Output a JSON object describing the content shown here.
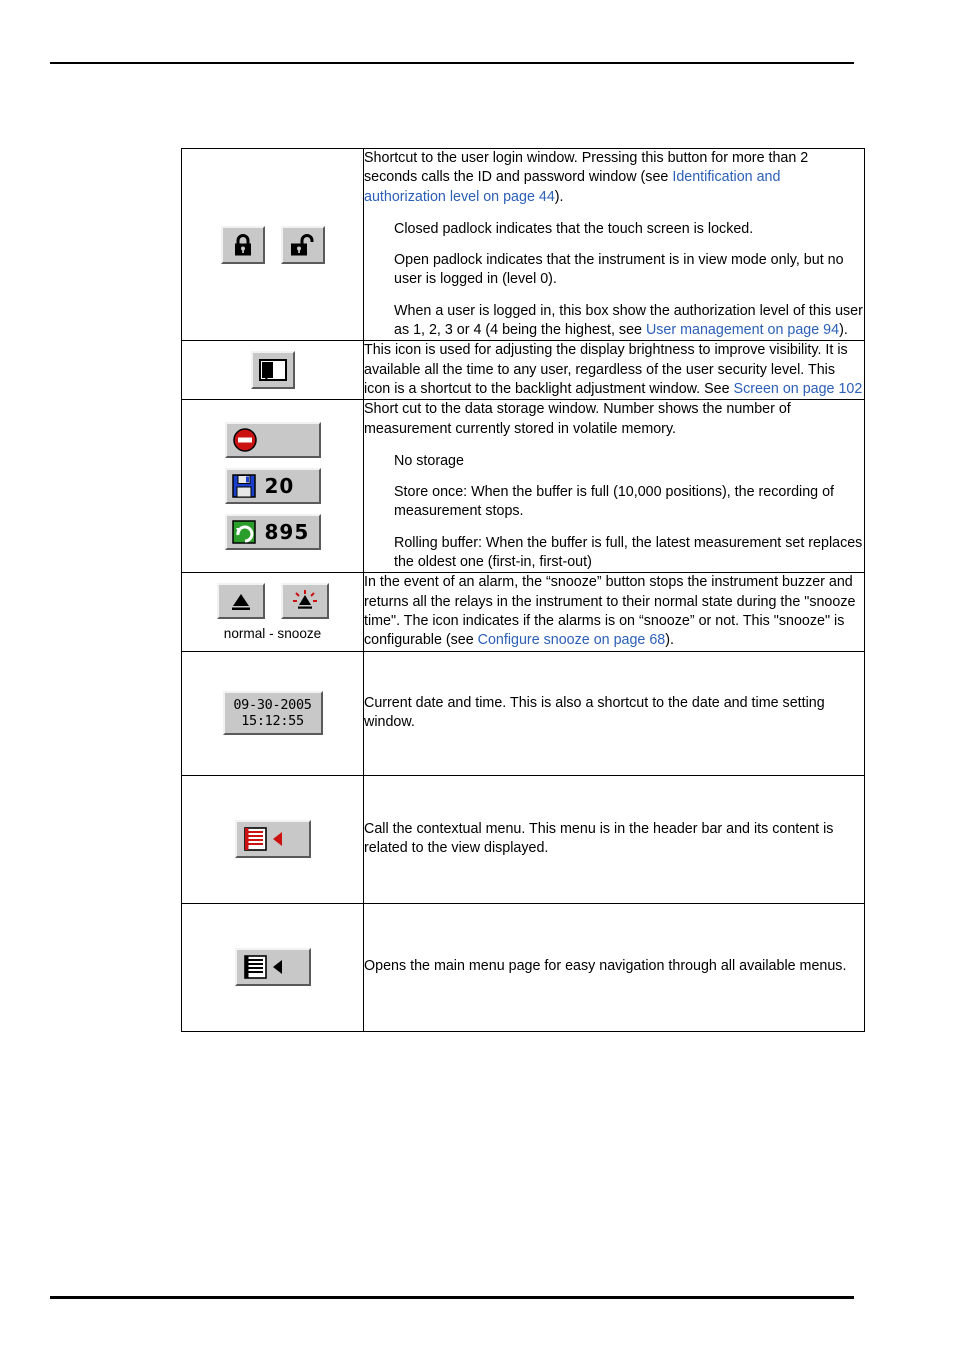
{
  "page": {
    "rows": [
      {
        "id": "login-lock",
        "icon_name": "padlock-icons",
        "paragraphs": [
          {
            "style": "flush",
            "segments": [
              {
                "text": "Shortcut to the user login window. Pressing this button for more than 2 seconds calls the ID and password window (see ",
                "link": false
              },
              {
                "text": "Identification and authorization level on page 44",
                "link": true
              },
              {
                "text": ").",
                "link": false
              }
            ]
          },
          {
            "style": "indent",
            "segments": [
              {
                "text": "Closed padlock indicates that the touch screen is locked.",
                "link": false
              }
            ]
          },
          {
            "style": "indent",
            "segments": [
              {
                "text": "Open padlock indicates that the instrument is in view mode only, but no user is logged in (level 0).",
                "link": false
              }
            ]
          },
          {
            "style": "indent",
            "segments": [
              {
                "text": "When a user is logged in, this box show the authorization level of this user as 1, 2, 3 or 4 (4 being the highest, see ",
                "link": false
              },
              {
                "text": "User management on page 94",
                "link": true
              },
              {
                "text": ").",
                "link": false
              }
            ]
          }
        ]
      },
      {
        "id": "brightness",
        "icon_name": "brightness-icon",
        "paragraphs": [
          {
            "style": "flush",
            "segments": [
              {
                "text": "This icon is used for adjusting the display brightness to improve visibility. It is available all the time to any user, regardless of the user security level. This icon is a shortcut to the backlight adjustment window. See ",
                "link": false
              },
              {
                "text": "Screen on page 102",
                "link": true
              }
            ]
          }
        ]
      },
      {
        "id": "data-storage",
        "icon_name": "storage-icons",
        "store_values": [
          "20",
          "895"
        ],
        "paragraphs": [
          {
            "style": "flush",
            "segments": [
              {
                "text": "Short cut to the data storage window. Number shows the number of measurement currently stored in volatile memory.",
                "link": false
              }
            ]
          },
          {
            "style": "indent",
            "segments": [
              {
                "text": "No storage",
                "link": false
              }
            ]
          },
          {
            "style": "indent",
            "segments": [
              {
                "text": "Store once: When the buffer is full (10,000 positions), the recording of measurement stops.",
                "link": false
              }
            ]
          },
          {
            "style": "indent",
            "segments": [
              {
                "text": "Rolling buffer: When the buffer is full, the latest measurement set replaces the oldest one (first-in, first-out)",
                "link": false
              }
            ]
          }
        ]
      },
      {
        "id": "snooze",
        "icon_name": "alarm-snooze-icons",
        "caption": "normal - snooze",
        "paragraphs": [
          {
            "style": "flush",
            "segments": [
              {
                "text": "In the event of an alarm, the “snooze” button stops the instrument buzzer and returns all the relays in the instrument to their normal state during the \"snooze time\". The icon indicates if the alarms is on “snooze” or not. This \"snooze\" is configurable (see ",
                "link": false
              },
              {
                "text": "Configure snooze on page 68",
                "link": true
              },
              {
                "text": ").",
                "link": false
              }
            ]
          }
        ]
      },
      {
        "id": "date-time",
        "icon_name": "date-time-icon",
        "date_text": "09-30-2005",
        "time_text": "15:12:55",
        "paragraphs": [
          {
            "style": "flush",
            "segments": [
              {
                "text": "Current date and time. This is also a shortcut to the date and time setting window.",
                "link": false
              }
            ]
          }
        ]
      },
      {
        "id": "contextual-menu",
        "icon_name": "contextual-menu-icon",
        "paragraphs": [
          {
            "style": "flush",
            "segments": [
              {
                "text": "Call the contextual menu. This menu is in the header bar and its content is related to the view displayed.",
                "link": false
              }
            ]
          }
        ]
      },
      {
        "id": "main-menu",
        "icon_name": "main-menu-icon",
        "paragraphs": [
          {
            "style": "flush",
            "segments": [
              {
                "text": "Opens the main menu page for easy navigation through all available menus.",
                "link": false
              }
            ]
          }
        ]
      }
    ]
  }
}
